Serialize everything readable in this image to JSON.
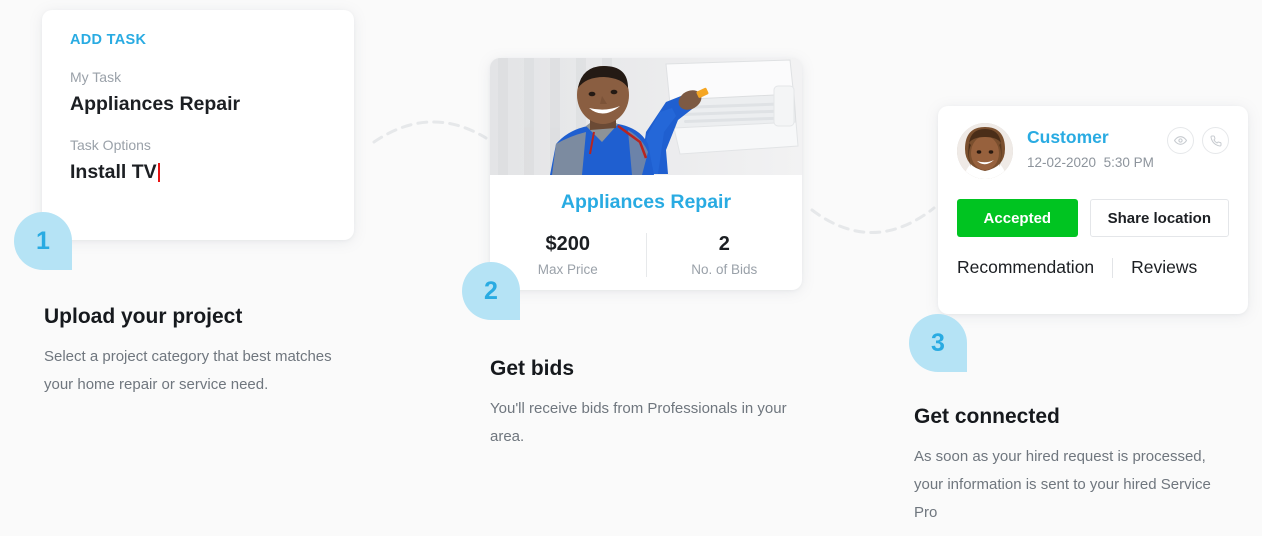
{
  "theme": {
    "background": "#fafafa",
    "accent_blue": "#29abe2",
    "badge_fill": "#b5e3f5",
    "accept_green": "#00c421",
    "caret_red": "#e81313",
    "text_dark": "#1c1f23",
    "text_muted": "#6f767e"
  },
  "add_task_card": {
    "heading": "ADD TASK",
    "task_label": "My Task",
    "task_value": "Appliances Repair",
    "options_label": "Task Options",
    "options_value": "Install TV"
  },
  "bid_card": {
    "photo_alt": "technician-repairing-air-conditioner",
    "title": "Appliances Repair",
    "stats": [
      {
        "value": "$200",
        "label": "Max Price"
      },
      {
        "value": "2",
        "label": "No. of Bids"
      }
    ]
  },
  "customer_card": {
    "avatar_alt": "customer-avatar-smiling-woman",
    "name": "Customer",
    "date": "12-02-2020",
    "time": "5:30 PM",
    "icons": [
      {
        "name": "eye-icon"
      },
      {
        "name": "phone-icon"
      }
    ],
    "accepted_label": "Accepted",
    "share_location_label": "Share location",
    "tabs": [
      {
        "label": "Recommendation"
      },
      {
        "label": "Reviews"
      }
    ]
  },
  "steps": [
    {
      "number": "1",
      "title": "Upload your project",
      "description": "Select a project category that best matches your home repair or service need."
    },
    {
      "number": "2",
      "title": "Get bids",
      "description": "You'll receive bids from Professionals in your area."
    },
    {
      "number": "3",
      "title": "Get connected",
      "description": "As soon as your hired request is processed, your information is sent to your hired Service Pro"
    }
  ]
}
